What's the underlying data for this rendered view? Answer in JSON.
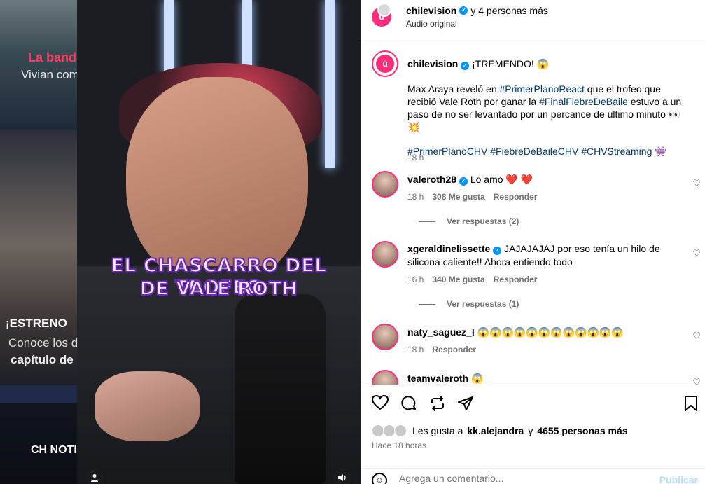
{
  "background": {
    "tile1_title": "La banda",
    "tile1_sub": "Vivian com",
    "tile2_title": "¡ESTRENO",
    "tile2_line1": "Conoce los d",
    "tile2_line2": "capítulo de l",
    "tile3_brand": "CH NOTIC"
  },
  "video": {
    "caption_line1": "EL CHASCARRO DEL TROFEO",
    "caption_line2": "DE VALE ROTH"
  },
  "header": {
    "username": "chilevision",
    "more": "y 4 personas más",
    "subtitle": "Audio original"
  },
  "caption": {
    "username": "chilevision",
    "headline": "¡TREMENDO! 😱",
    "body_pre": "Max Araya reveló en ",
    "tag1": "#PrimerPlanoReact",
    "body_mid": " que el trofeo que recibió Vale Roth por ganar la ",
    "tag2": "#FinalFiebreDeBaile",
    "body_post": " estuvo a un paso de no ser levantado por un percance de último minuto 👀 💥",
    "tags_line": "#PrimerPlanoCHV #FiebreDeBaileCHV #CHVStreaming",
    "time": "18 h"
  },
  "comments": [
    {
      "username": "valeroth28",
      "text": "Lo amo ❤️ ❤️",
      "time": "18 h",
      "likes": "308 Me gusta",
      "reply": "Responder",
      "view_replies": "Ver respuestas (2)"
    },
    {
      "username": "xgeraldinelissette",
      "text": "JAJAJAJAJ por eso tenía un hilo de silicona caliente!! Ahora entiendo todo",
      "time": "16 h",
      "likes": "340 Me gusta",
      "reply": "Responder",
      "view_replies": "Ver respuestas (1)"
    },
    {
      "username": "naty_saguez_l",
      "text": "😱😱😱😱😱😱😱😱😱😱😱😱",
      "time": "18 h",
      "reply": "Responder"
    },
    {
      "username": "teamvaleroth",
      "text": "😱"
    }
  ],
  "footer": {
    "likes_prefix": "Les gusta a",
    "likes_user": "kk.alejandra",
    "likes_mid": "y",
    "likes_count": "4655 personas más",
    "ago": "Hace 18 horas",
    "comment_placeholder": "Agrega un comentario...",
    "publish": "Publicar"
  },
  "colors": {
    "brand": "#ff2d7a",
    "link": "#00376b",
    "verified": "#0095f6"
  }
}
